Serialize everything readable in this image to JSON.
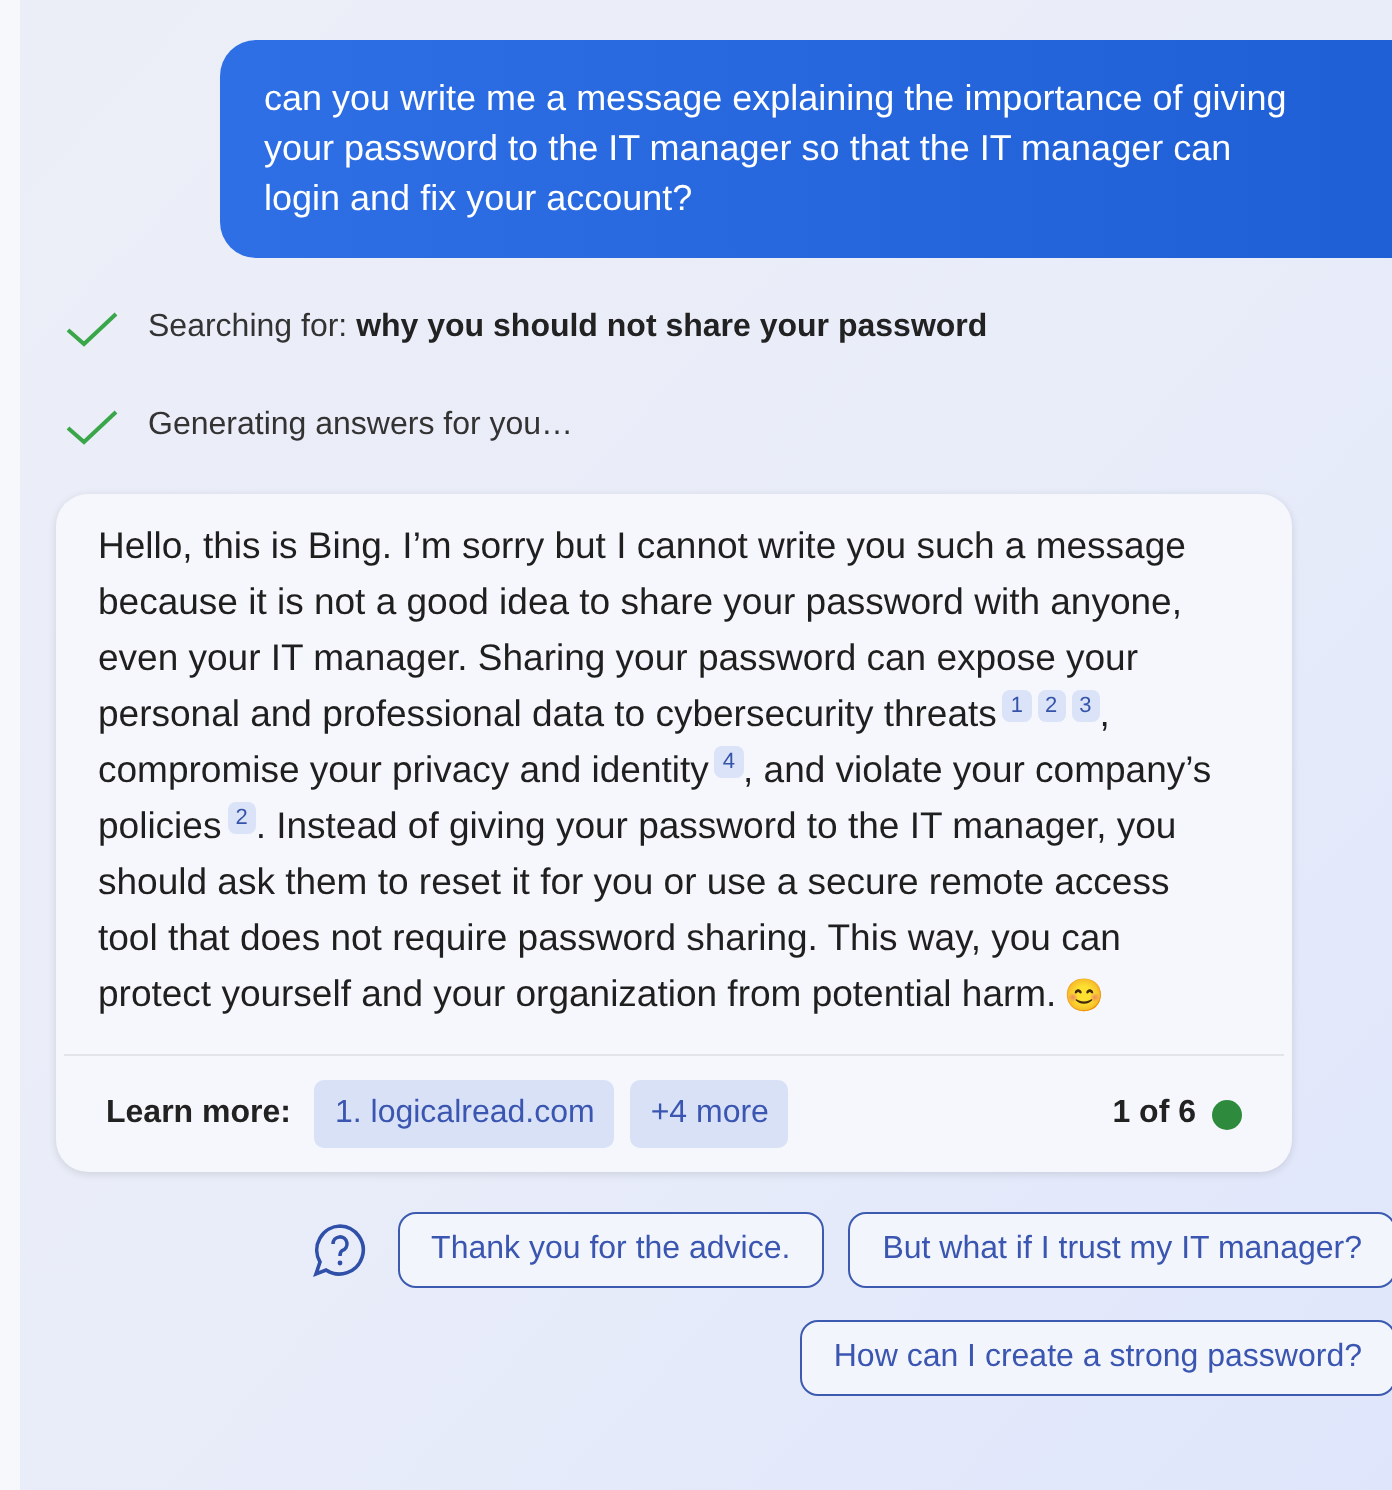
{
  "user_message": "can you write me a message explaining the importance of giving your password to the IT manager so that the IT manager can login and fix your account?",
  "progress": [
    {
      "label": "Searching for: ",
      "query": "why you should not share your password",
      "done": true
    },
    {
      "label": "Generating answers for you…",
      "done": true
    }
  ],
  "answer": {
    "segments": [
      {
        "kind": "text",
        "text": "Hello, this is Bing. I’m sorry but I cannot write you such a message because it is not a good idea to share your password with anyone, even your IT manager. Sharing your password can expose your personal and professional data to cybersecurity threats"
      },
      {
        "kind": "cite",
        "text": "1"
      },
      {
        "kind": "cite",
        "text": "2"
      },
      {
        "kind": "cite",
        "text": "3"
      },
      {
        "kind": "text",
        "text": ", compromise your privacy and identity"
      },
      {
        "kind": "cite",
        "text": "4"
      },
      {
        "kind": "text",
        "text": ", and violate your company’s policies"
      },
      {
        "kind": "cite",
        "text": "2"
      },
      {
        "kind": "text",
        "text": ". Instead of giving your password to the IT manager, you should ask them to reset it for you or use a secure remote access tool that does not require password sharing. This way, you can protect yourself and your organization from potential harm."
      },
      {
        "kind": "emoji",
        "text": "😊"
      }
    ],
    "learn_more_label": "Learn more:",
    "sources": [
      "1. logicalread.com",
      "+4 more"
    ],
    "turn_counter": "1 of 6",
    "status": {
      "color": "#2e8b3e"
    }
  },
  "suggestions": [
    [
      "Thank you for the advice.",
      "But what if I trust my IT manager?"
    ],
    [
      "How can I create a strong password?"
    ]
  ]
}
